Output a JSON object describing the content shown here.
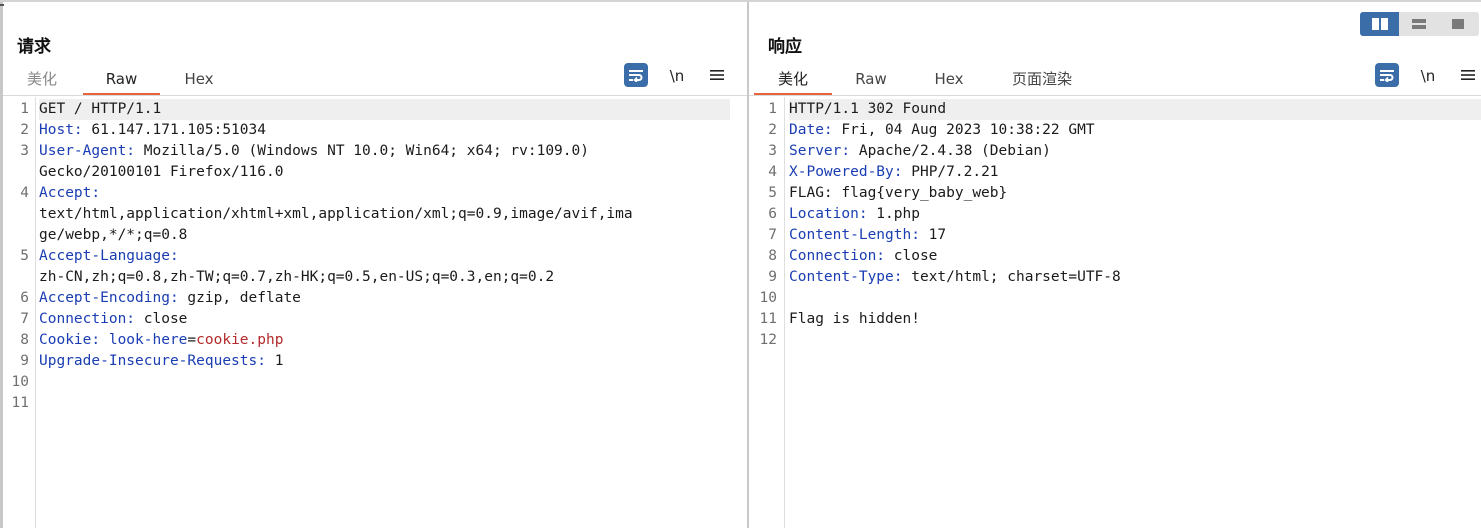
{
  "request": {
    "title": "请求",
    "tabs": [
      "美化",
      "Raw",
      "Hex"
    ],
    "active_tab": "Raw",
    "newline_label": "\\n",
    "lines": [
      {
        "n": "1",
        "segs": [
          {
            "t": "GET / HTTP/1.1",
            "c": "v"
          }
        ]
      },
      {
        "n": "2",
        "segs": [
          {
            "t": "Host:",
            "c": "k"
          },
          {
            "t": " 61.147.171.105:51034",
            "c": "v"
          }
        ]
      },
      {
        "n": "3",
        "segs": [
          {
            "t": "User-Agent:",
            "c": "k"
          },
          {
            "t": " Mozilla/5.0 (Windows NT 10.0; Win64; x64; rv:109.0)",
            "c": "v"
          }
        ]
      },
      {
        "n": "",
        "segs": [
          {
            "t": "Gecko/20100101 Firefox/116.0",
            "c": "v"
          }
        ]
      },
      {
        "n": "4",
        "segs": [
          {
            "t": "Accept:",
            "c": "k"
          }
        ]
      },
      {
        "n": "",
        "segs": [
          {
            "t": "text/html,application/xhtml+xml,application/xml;q=0.9,image/avif,ima",
            "c": "v"
          }
        ]
      },
      {
        "n": "",
        "segs": [
          {
            "t": "ge/webp,*/*;q=0.8",
            "c": "v"
          }
        ]
      },
      {
        "n": "5",
        "segs": [
          {
            "t": "Accept-Language:",
            "c": "k"
          }
        ]
      },
      {
        "n": "",
        "segs": [
          {
            "t": "zh-CN,zh;q=0.8,zh-TW;q=0.7,zh-HK;q=0.5,en-US;q=0.3,en;q=0.2",
            "c": "v"
          }
        ]
      },
      {
        "n": "6",
        "segs": [
          {
            "t": "Accept-Encoding:",
            "c": "k"
          },
          {
            "t": " gzip, deflate",
            "c": "v"
          }
        ]
      },
      {
        "n": "7",
        "segs": [
          {
            "t": "Connection:",
            "c": "k"
          },
          {
            "t": " close",
            "c": "v"
          }
        ]
      },
      {
        "n": "8",
        "segs": [
          {
            "t": "Cookie:",
            "c": "k"
          },
          {
            "t": " ",
            "c": "v"
          },
          {
            "t": "look-here",
            "c": "ck"
          },
          {
            "t": "=",
            "c": "v"
          },
          {
            "t": "cookie.php",
            "c": "cv"
          }
        ]
      },
      {
        "n": "9",
        "segs": [
          {
            "t": "Upgrade-Insecure-Requests:",
            "c": "k"
          },
          {
            "t": " 1",
            "c": "v"
          }
        ]
      },
      {
        "n": "10",
        "segs": []
      },
      {
        "n": "11",
        "segs": []
      }
    ]
  },
  "response": {
    "title": "响应",
    "tabs": [
      "美化",
      "Raw",
      "Hex",
      "页面渲染"
    ],
    "active_tab": "美化",
    "newline_label": "\\n",
    "lines": [
      {
        "n": "1",
        "segs": [
          {
            "t": "HTTP/1.1 302 Found",
            "c": "v"
          }
        ]
      },
      {
        "n": "2",
        "segs": [
          {
            "t": "Date:",
            "c": "k"
          },
          {
            "t": " Fri, 04 Aug 2023 10:38:22 GMT",
            "c": "v"
          }
        ]
      },
      {
        "n": "3",
        "segs": [
          {
            "t": "Server:",
            "c": "k"
          },
          {
            "t": " Apache/2.4.38 (Debian)",
            "c": "v"
          }
        ]
      },
      {
        "n": "4",
        "segs": [
          {
            "t": "X-Powered-By:",
            "c": "k"
          },
          {
            "t": " PHP/7.2.21",
            "c": "v"
          }
        ]
      },
      {
        "n": "5",
        "segs": [
          {
            "t": "FLAG: flag{very_baby_web}",
            "c": "v"
          }
        ]
      },
      {
        "n": "6",
        "segs": [
          {
            "t": "Location:",
            "c": "k"
          },
          {
            "t": " 1.php",
            "c": "v"
          }
        ]
      },
      {
        "n": "7",
        "segs": [
          {
            "t": "Content-Length:",
            "c": "k"
          },
          {
            "t": " 17",
            "c": "v"
          }
        ]
      },
      {
        "n": "8",
        "segs": [
          {
            "t": "Connection:",
            "c": "k"
          },
          {
            "t": " close",
            "c": "v"
          }
        ]
      },
      {
        "n": "9",
        "segs": [
          {
            "t": "Content-Type:",
            "c": "k"
          },
          {
            "t": " text/html; charset=UTF-8",
            "c": "v"
          }
        ]
      },
      {
        "n": "10",
        "segs": []
      },
      {
        "n": "11",
        "segs": [
          {
            "t": "Flag is hidden!",
            "c": "v"
          }
        ]
      },
      {
        "n": "12",
        "segs": []
      }
    ]
  },
  "icons": {
    "word_wrap": "word-wrap-icon",
    "menu": "hamburger-menu-icon",
    "layout_side_by_side": "split-horizontal-icon",
    "layout_stacked": "split-vertical-icon",
    "layout_single": "single-pane-icon"
  },
  "colors": {
    "accent_tab": "#e8643c",
    "button_blue": "#3b6ea8",
    "header_key": "#1a3db3",
    "cookie_value": "#b32b2b"
  }
}
